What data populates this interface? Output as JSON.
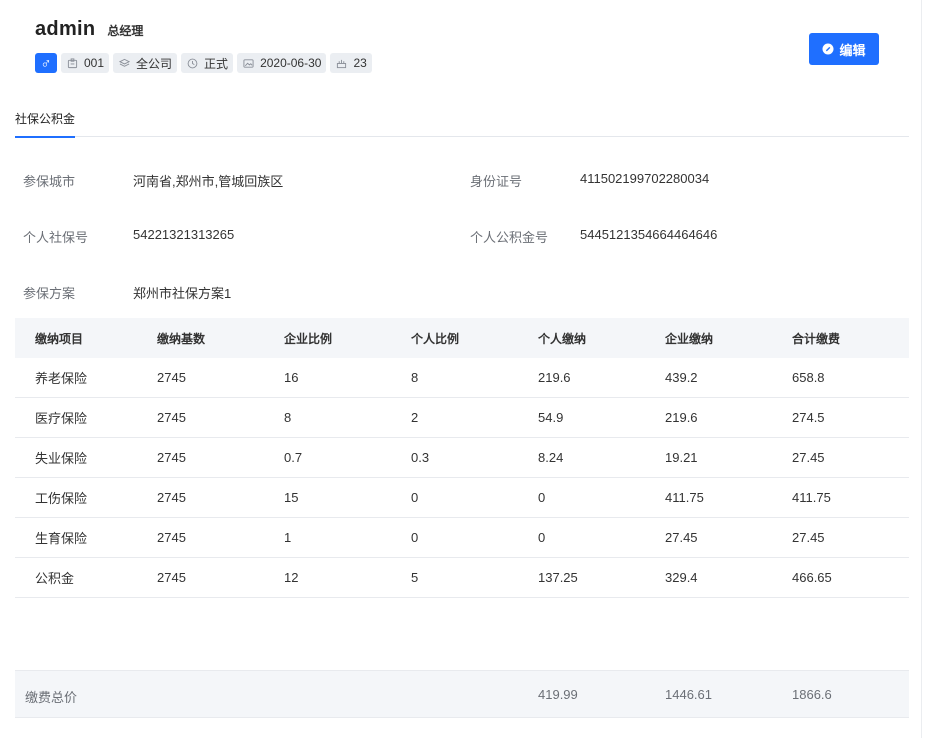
{
  "header": {
    "name": "admin",
    "role": "总经理",
    "tags": {
      "id": "001",
      "company": "全公司",
      "status": "正式",
      "date": "2020-06-30",
      "age": "23"
    },
    "edit_label": "编辑"
  },
  "tabs": [
    {
      "label": "社保公积金",
      "active": true
    }
  ],
  "info": {
    "city_label": "参保城市",
    "city_value": "河南省,郑州市,管城回族区",
    "id_label": "身份证号",
    "id_value": "411502199702280034",
    "social_no_label": "个人社保号",
    "social_no_value": "54221321313265",
    "fund_no_label": "个人公积金号",
    "fund_no_value": "5445121354664464646",
    "plan_label": "参保方案",
    "plan_value": "郑州市社保方案1"
  },
  "table": {
    "headers": [
      "缴纳项目",
      "缴纳基数",
      "企业比例",
      "个人比例",
      "个人缴纳",
      "企业缴纳",
      "合计缴费"
    ],
    "rows": [
      [
        "养老保险",
        "2745",
        "16",
        "8",
        "219.6",
        "439.2",
        "658.8"
      ],
      [
        "医疗保险",
        "2745",
        "8",
        "2",
        "54.9",
        "219.6",
        "274.5"
      ],
      [
        "失业保险",
        "2745",
        "0.7",
        "0.3",
        "8.24",
        "19.21",
        "27.45"
      ],
      [
        "工伤保险",
        "2745",
        "15",
        "0",
        "0",
        "411.75",
        "411.75"
      ],
      [
        "生育保险",
        "2745",
        "1",
        "0",
        "0",
        "27.45",
        "27.45"
      ],
      [
        "公积金",
        "2745",
        "12",
        "5",
        "137.25",
        "329.4",
        "466.65"
      ]
    ]
  },
  "total": {
    "label": "缴费总价",
    "personal": "419.99",
    "company": "1446.61",
    "sum": "1866.6"
  },
  "colors": {
    "accent": "#1f6fff",
    "tag_bg": "#ebeef2",
    "table_header_bg": "#f4f6f9"
  }
}
